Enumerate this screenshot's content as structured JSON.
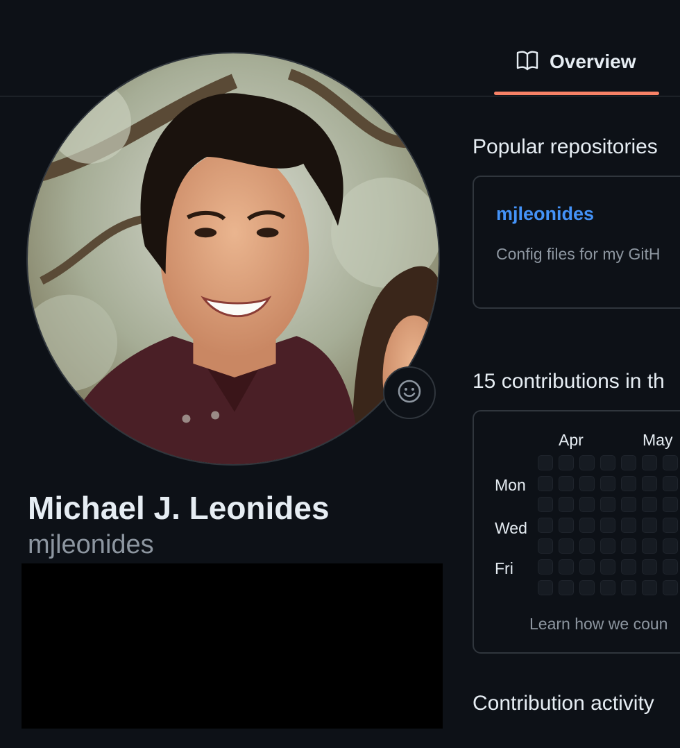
{
  "nav": {
    "tabs": [
      {
        "label": "Overview",
        "icon": "book-icon",
        "selected": true
      }
    ],
    "accent_color": "#f78166"
  },
  "profile": {
    "name": "Michael J. Leonides",
    "login": "mjleonides",
    "status_icon": "smiley-icon"
  },
  "popular": {
    "title": "Popular repositories",
    "repos": [
      {
        "name": "mjleonides",
        "description": "Config files for my GitH"
      }
    ]
  },
  "contributions": {
    "title": "15 contributions in th",
    "months": [
      "Apr",
      "May"
    ],
    "days": [
      "Mon",
      "Wed",
      "Fri"
    ],
    "learn_text": "Learn how we coun"
  },
  "activity": {
    "title": "Contribution activity"
  },
  "colors": {
    "background": "#0d1117",
    "border": "#30363d",
    "link": "#4493f8",
    "muted": "#8d96a0"
  }
}
